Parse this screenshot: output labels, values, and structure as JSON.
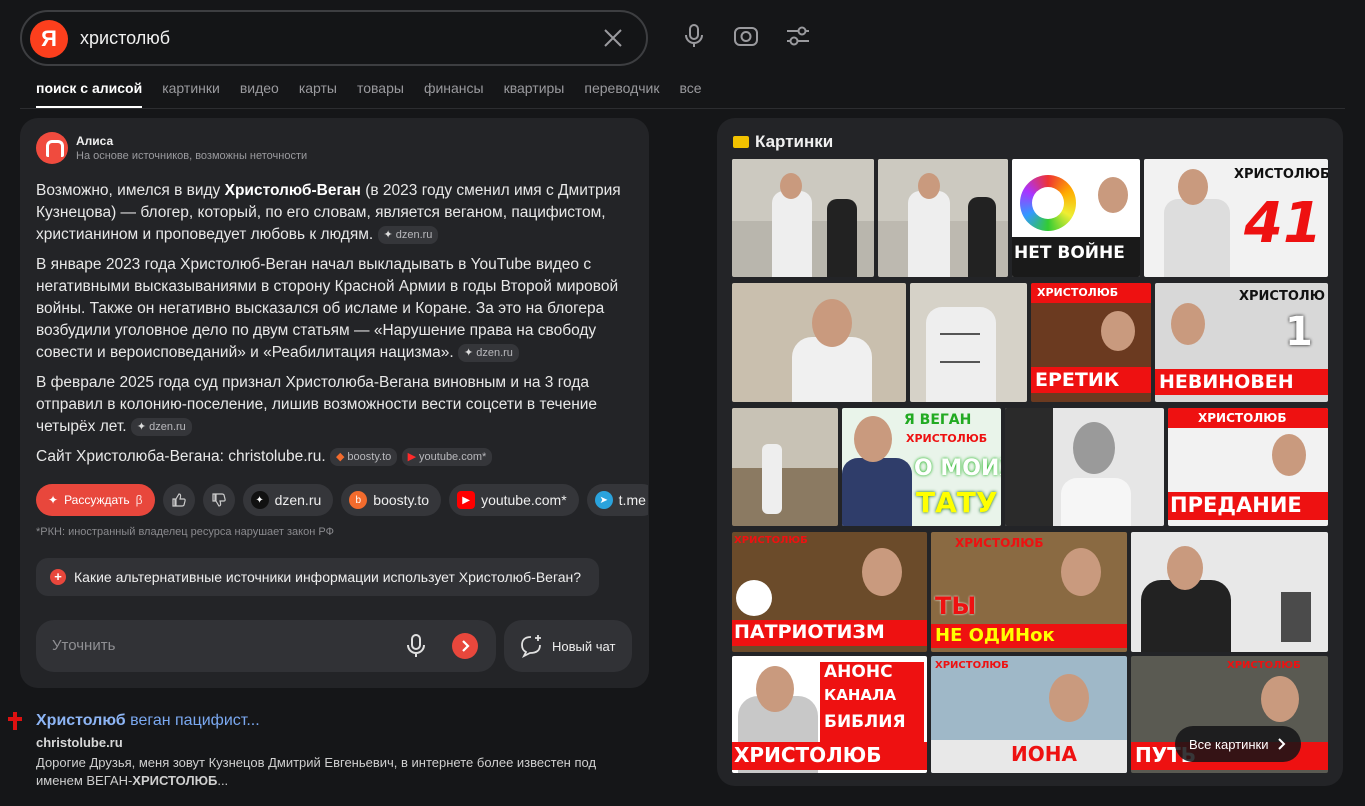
{
  "search": {
    "query": "христолюб",
    "logo_letter": "Я"
  },
  "tabs": [
    "поиск с алисой",
    "картинки",
    "видео",
    "карты",
    "товары",
    "финансы",
    "квартиры",
    "переводчик",
    "все"
  ],
  "alice": {
    "name": "Алиса",
    "subtitle": "На основе источников, возможны неточности",
    "p1": {
      "pre": "Возможно, имелся в виду ",
      "bold": "Христолюб-Веган",
      "post": " (в 2023 году сменил имя с Дмитрия Кузнецова) — блогер, который, по его словам, является веганом, пацифистом, христианином и проповедует любовь к людям.",
      "src": "dzen.ru"
    },
    "p2": {
      "text": "В январе 2023 года Христолюб-Веган начал выкладывать в YouTube видео с негативными высказываниями в сторону Красной Армии в годы Второй мировой войны. Также он негативно высказался об исламе и Коране. За это на блогера возбудили уголовное дело по двум статьям — «Нарушение права на свободу совести и вероисповеданий» и «Реабилитация нацизма».",
      "src": "dzen.ru"
    },
    "p3": {
      "text": "В феврале 2025 года суд признал Христолюба-Вегана виновным и на 3 года отправил в колонию-поселение, лишив возможности вести соцсети в течение четырёх лет.",
      "src": "dzen.ru"
    },
    "p4": {
      "text": "Сайт Христолюба-Вегана: christolube.ru.",
      "src1": "boosty.to",
      "src2": "youtube.com*"
    },
    "reason_button": "Рассуждать",
    "reason_badge": "β",
    "chips": [
      "dzen.ru",
      "boosty.to",
      "youtube.com*",
      "t.me"
    ],
    "rkn_note": "*РКН: иностранный владелец ресурса нарушает закон РФ",
    "suggested_question": "Какие альтернативные источники информации использует Христолюб-Веган?",
    "refine_placeholder": "Уточнить",
    "new_chat": "Новый чат"
  },
  "result": {
    "title_bold": "Христолюб",
    "title_rest": " веган пацифист...",
    "url": "christolube.ru",
    "snippet_pre": "Дорогие Друзья, меня зовут Кузнецов Дмитрий Евгеньевич, в интернете более известен под именем ВЕГАН-",
    "snippet_bold": "ХРИСТОЛЮБ",
    "snippet_post": "..."
  },
  "images": {
    "title": "Картинки",
    "captions": {
      "t3": "НЕТ ВОЙНЕ",
      "t4a": "ХРИСТОЛЮБ",
      "t4b": "41",
      "t7a": "ХРИСТОЛЮБ",
      "t7b": "ЕРЕТИК",
      "t8a": "ХРИСТОЛЮ",
      "t8b": "1",
      "t8c": "НЕВИНОВЕН",
      "t10a": "Я ВЕГАН",
      "t10b": "ХРИСТОЛЮБ",
      "t10c": "О МОИХ",
      "t10d": "ТАТУ",
      "t12a": "ХРИСТОЛЮБ",
      "t12b": "ПРЕДАНИЕ",
      "t13a": "ХРИСТОЛЮБ",
      "t13b": "ПАТРИОТИЗМ",
      "t14a": "ХРИСТОЛЮБ",
      "t14b": "ТЫ",
      "t14c": "НЕ ОДИНок",
      "t16a": "АНОНС",
      "t16b": "КАНАЛА",
      "t16c": "БИБЛИЯ",
      "t16d": "ХРИСТОЛЮБ",
      "t17a": "ХРИСТОЛЮБ",
      "t17b": "ИОНА",
      "t18a": "ХРИСТОЛЮБ",
      "t18b": "ПУТЬ"
    },
    "all_button": "Все картинки"
  },
  "colors": {
    "accent": "#e8473c",
    "bg": "#151618",
    "card": "#232427",
    "link": "#7aa8f0"
  }
}
